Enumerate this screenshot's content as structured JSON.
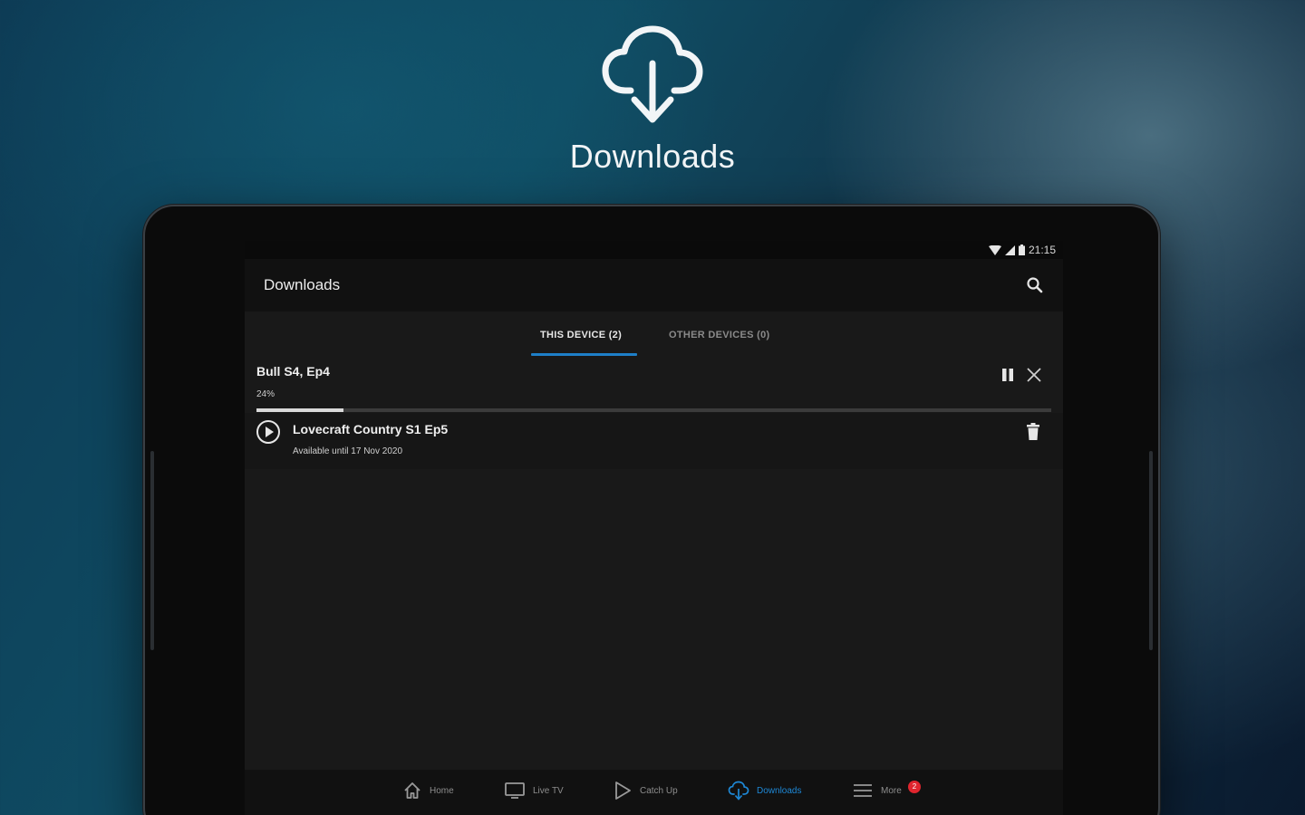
{
  "hero": {
    "title": "Downloads",
    "icon": "cloud-download-icon"
  },
  "status_bar": {
    "time": "21:15",
    "icons": [
      "wifi-icon",
      "signal-icon",
      "battery-icon"
    ]
  },
  "app_bar": {
    "title": "Downloads",
    "search_icon": "search-icon"
  },
  "tabs": [
    {
      "label": "THIS DEVICE (2)",
      "active": true
    },
    {
      "label": "OTHER DEVICES (0)",
      "active": false
    }
  ],
  "downloads": [
    {
      "title": "Bull  S4, Ep4",
      "status": "24%",
      "progress": 0.11,
      "actions": [
        "pause-icon",
        "close-icon"
      ]
    },
    {
      "title": "Lovecraft Country  S1 Ep5",
      "status": "Available until 17 Nov 2020",
      "actions": [
        "play-icon",
        "delete-icon"
      ]
    }
  ],
  "bottom_nav": [
    {
      "label": "Home",
      "icon": "home-icon",
      "active": false
    },
    {
      "label": "Live TV",
      "icon": "tv-icon",
      "active": false
    },
    {
      "label": "Catch Up",
      "icon": "play-outline-icon",
      "active": false
    },
    {
      "label": "Downloads",
      "icon": "cloud-download-icon",
      "active": true
    },
    {
      "label": "More",
      "icon": "menu-icon",
      "active": false,
      "badge": "2"
    }
  ],
  "colors": {
    "accent": "#1e7fc8",
    "badge": "#e0252e",
    "screen_bg": "#191919"
  }
}
